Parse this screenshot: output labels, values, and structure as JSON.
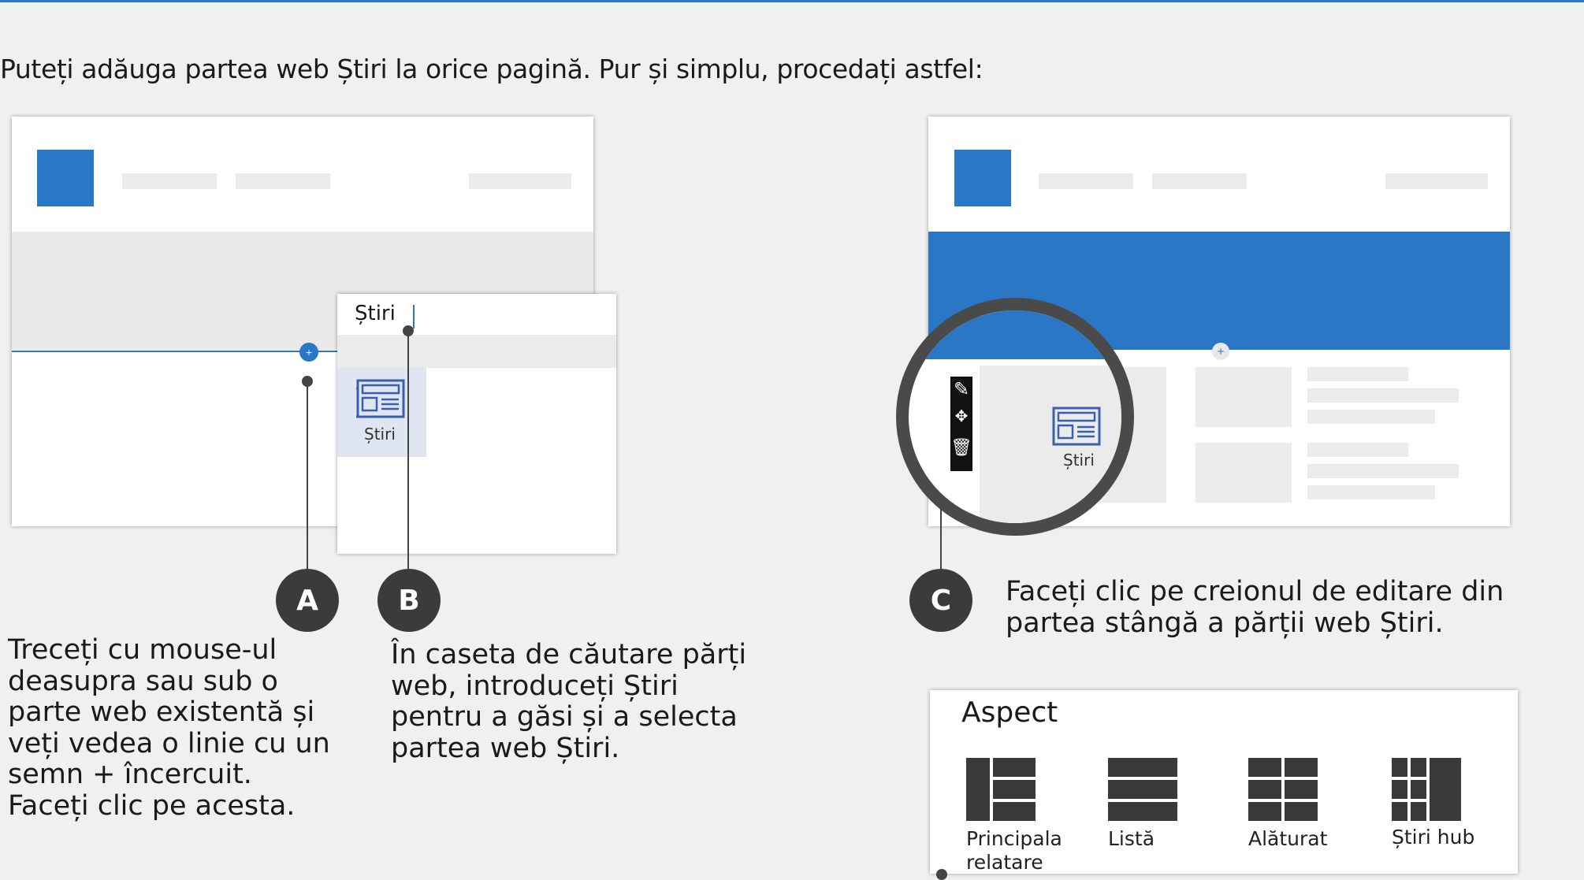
{
  "intro_text": "Puteți adăuga partea web Știri la orice pagină. Pur și simplu, procedați astfel:",
  "search_panel": {
    "query": "Știri",
    "result_label": "Știri"
  },
  "magnified_webpart_label": "Știri",
  "steps": [
    {
      "letter": "A",
      "text": "Treceți cu mouse-ul deasupra sau sub o parte web existentă și veți vedea o linie cu un semn + încercuit. Faceți clic pe acesta."
    },
    {
      "letter": "B",
      "text": "În caseta de căutare părți web, introduceți Știri pentru a găsi și a selecta partea web Știri."
    },
    {
      "letter": "C",
      "text": "Faceți clic pe creionul de editare din partea stângă a părții web Știri."
    }
  ],
  "aspect_panel": {
    "title": "Aspect",
    "options": [
      {
        "label": "Principala relatare"
      },
      {
        "label": "Listă"
      },
      {
        "label": "Alăturat"
      },
      {
        "label": "Știri hub"
      }
    ]
  },
  "colors": {
    "accent": "#2a78c5",
    "callout": "#3b3b3b"
  },
  "icons": [
    "plus-icon",
    "news-icon",
    "pencil-icon",
    "move-icon",
    "trash-icon"
  ]
}
